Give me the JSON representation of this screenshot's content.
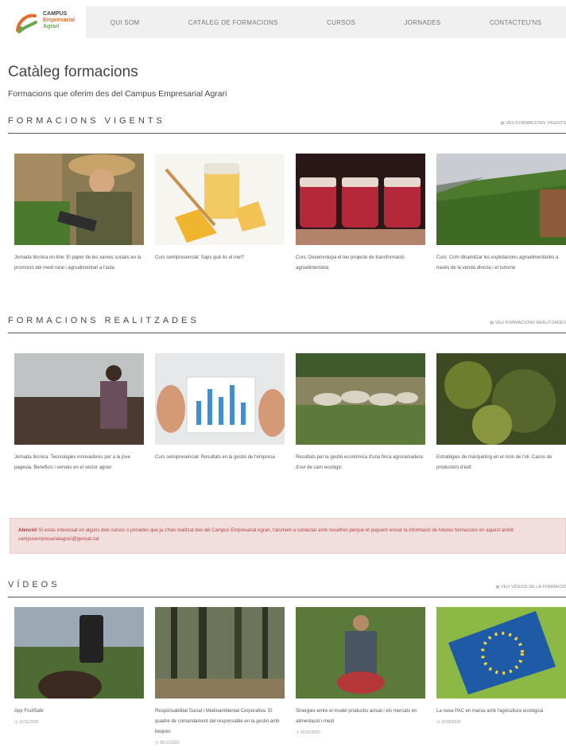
{
  "logo": {
    "line1": "CAMPUS",
    "line2": "Empresarial",
    "line3": "Agrari"
  },
  "nav": [
    "Qui som",
    "Catàleg de formacions",
    "Cursos",
    "Jornades",
    "Contacteu'ns"
  ],
  "page": {
    "title": "Catàleg formacions",
    "subtitle": "Formacions que oferim des del Campus Empresarial Agrari"
  },
  "sections": {
    "vigents": {
      "title": "FORMACIONS VIGENTS",
      "link": "Veu formacions vigents",
      "cards": [
        {
          "text": "Jornada tècnica on-line: El paper de les xarxes socials en la promoció del medi rural i agroalimentari a l'aula",
          "img": "farmer-tablet"
        },
        {
          "text": "Curs semipresencial: Saps què és el mel?",
          "img": "honey"
        },
        {
          "text": "Curs: Desenvolupa el teu projecte de transformació agroalimentària",
          "img": "jam-jars"
        },
        {
          "text": "Curs: Com dinamitzar les explotacions agroalimentàries a través de la venda directa i el turisme",
          "img": "vineyard"
        }
      ]
    },
    "realitzades": {
      "title": "FORMACIONS REALITZADES",
      "link": "Veu formacions realitzades",
      "cards": [
        {
          "text": "Jornada tècnica: Tecnologies innovadores per a la jove pagesia. Beneficis i serveis en el sector agrari",
          "img": "field-person"
        },
        {
          "text": "Curs semipresencial: Resultats en la gestió de l'empresa",
          "img": "tablet-chart"
        },
        {
          "text": "Resultats per la gestió econòmica d'una finca agroramadera d'oví de carn ecològic",
          "img": "sheep"
        },
        {
          "text": "Estratègies de màrqueting en el món de l'oli. Casos de productors d'èxit",
          "img": "olives"
        }
      ]
    },
    "videos": {
      "title": "VÍDEOS",
      "link": "Veu vídeos de la formació",
      "cards": [
        {
          "text": "App FruitSafe",
          "meta": "12/11/2020",
          "img": "phone-field"
        },
        {
          "text": "Responsabilitat Social i Medioambiental Corporativa. El quadre de comandament del responsable en la gestió amb beques",
          "meta": "05/11/2020",
          "img": "forest"
        },
        {
          "text": "Sinergies entre el model productiu actual i els mercats en alimentació i medi",
          "meta": "02/10/2020",
          "img": "farmer-veg"
        },
        {
          "text": "La nova PAC en marxa amb l'agricultura ecològica",
          "meta": "15/09/2020",
          "img": "eu-field"
        }
      ]
    }
  },
  "alert": {
    "bold": "Atenció!",
    "text": " Si estàs interessat en alguns dels cursos o jornades que ja s'han realitzat des del Campus Empresarial Agrari, t'animem a contactar amb nosaltres perquè et puguem enviar la informació de futures formacions en aquest àmbit: campusempresarialagrari@gencat.cat"
  },
  "colors": {
    "accent": "#e8692b",
    "green": "#6aa84f",
    "alert_bg": "#f3dede",
    "alert_text": "#b04545"
  }
}
